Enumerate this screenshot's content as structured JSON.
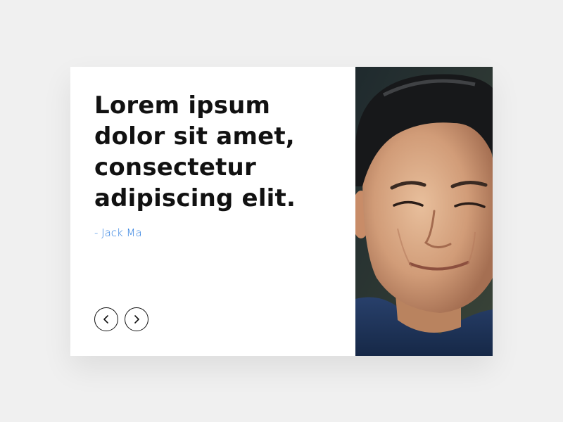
{
  "testimonial": {
    "quote": "Lorem ipsum dolor sit amet, consectetur adipiscing elit.",
    "author": "- Jack Ma"
  },
  "navigation": {
    "prev_icon": "chevron-left-icon",
    "next_icon": "chevron-right-icon"
  },
  "colors": {
    "page_background": "#f0f0f0",
    "card_background": "#ffffff",
    "quote_text": "#111111",
    "author_accent": "#2f7fe0"
  }
}
